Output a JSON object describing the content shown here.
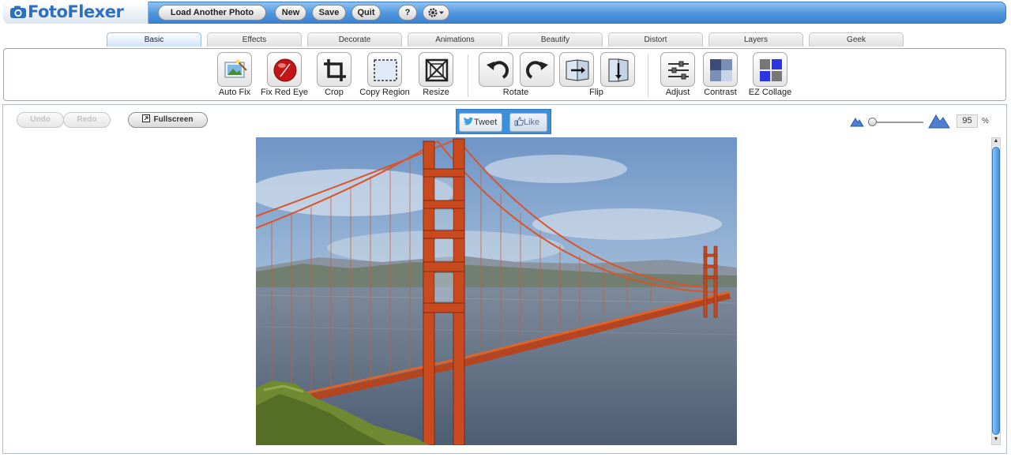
{
  "app": {
    "name": "FotoFlexer"
  },
  "topbar": {
    "load_label": "Load Another Photo",
    "new_label": "New",
    "save_label": "Save",
    "quit_label": "Quit",
    "help_label": "?"
  },
  "tabs": [
    "Basic",
    "Effects",
    "Decorate",
    "Animations",
    "Beautify",
    "Distort",
    "Layers",
    "Geek"
  ],
  "active_tab": "Basic",
  "tools": {
    "auto_fix": "Auto Fix",
    "fix_red_eye": "Fix Red Eye",
    "crop": "Crop",
    "copy_region": "Copy Region",
    "resize": "Resize",
    "rotate": "Rotate",
    "flip": "Flip",
    "adjust": "Adjust",
    "contrast": "Contrast",
    "ez_collage": "EZ Collage"
  },
  "workspace": {
    "undo_label": "Undo",
    "redo_label": "Redo",
    "fullscreen_label": "Fullscreen",
    "tweet_label": "Tweet",
    "like_label": "Like",
    "zoom_value": "95",
    "zoom_unit": "%"
  },
  "colors": {
    "accent": "#3c8fd9",
    "logo": "#2f6fc0"
  }
}
